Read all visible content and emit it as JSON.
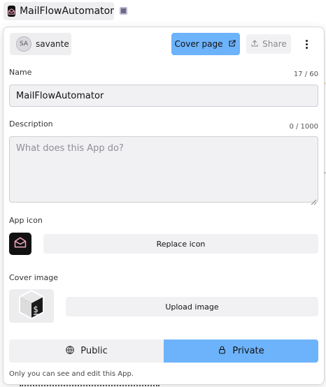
{
  "top_bar": {
    "app_name": "MailFlowAutomator"
  },
  "panel": {
    "owner": {
      "initials": "SA",
      "name": "savante"
    },
    "actions": {
      "cover_page_label": "Cover page",
      "share_label": "Share"
    },
    "name_field": {
      "label": "Name",
      "counter": "17 / 60",
      "value": "MailFlowAutomator"
    },
    "description_field": {
      "label": "Description",
      "counter": "0 / 1000",
      "placeholder": "What does this App do?"
    },
    "app_icon": {
      "label": "App icon",
      "replace_label": "Replace icon"
    },
    "cover_image": {
      "label": "Cover image",
      "upload_label": "Upload image"
    },
    "visibility": {
      "options": [
        "Public",
        "Private"
      ],
      "selected": "Private",
      "note": "Only you can see and edit this App."
    }
  },
  "colors": {
    "accent": "#6db3fb",
    "field_bg": "#f1f1f3",
    "icon_bg": "#111111"
  },
  "icons": [
    "mail-open-icon",
    "external-link-icon",
    "upload-icon",
    "more-vertical-icon",
    "globe-icon",
    "lock-icon",
    "terminal-icon"
  ]
}
